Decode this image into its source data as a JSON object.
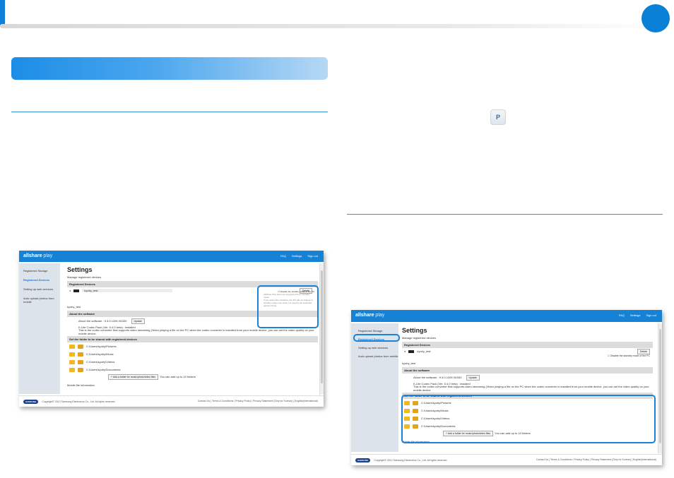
{
  "app": {
    "logo_main": "allshare",
    "logo_sub": "play",
    "nav": [
      "FAQ",
      "Settings",
      "Sign out"
    ]
  },
  "sidebar": {
    "items": [
      "Registered Storage",
      "Registered Devices",
      "Setting up web services",
      "Auto upload photos from mobile"
    ]
  },
  "settings": {
    "title": "Settings",
    "subtitle": "Manage registered devices",
    "registered_devices_label": "Registered Devices",
    "device_name": "kyoby_test",
    "delete_label": "Delete",
    "standby_label": "Disable the standby mode of the PC",
    "standby_note_1": "AllShare Play does not recognize PCs in standby mode.",
    "standby_note_2": "If you select this checkbox, the PC will not change to standby mode even when not used for an extended period of time.",
    "device_heading": "kyoby_test",
    "about_label": "About the software",
    "about_version": "About the software : 9.3.0.1206 N1530",
    "update_label": "Update",
    "codec": "K-Lite Codec Pack (Ver. 5.4.0 beta) : installed",
    "codec_note": "This is the codec converter that supports video streaming (Video playing a file on the PC when the codec converter is installed from your mobile device, you can set the video quality on your mobile device.",
    "folders_label": "Set the folder to be shared with registered devices",
    "folders": [
      "C:\\Users\\kyoby\\Pictures",
      "C:\\Users\\kyoby\\Music",
      "C:\\Users\\kyoby\\Videos",
      "C:\\Users\\kyoby\\Documents"
    ],
    "add_folder_label": "+ Add a folder for music/photo/video files",
    "add_folder_note": "You can add up to 10 folders",
    "mobile_label": "Mobile file information"
  },
  "footer": {
    "samsung": "SAMSUNG",
    "copyright": "Copyright© 2012 Samsung Electronics Co., Ltd. All rights reserved",
    "links": [
      "Contact Us",
      "Terms & Conditions / Privacy Policy",
      "Privacy Statement (Only for Korean)",
      "English(International)"
    ]
  },
  "colors": {
    "accent": "#1682d6",
    "highlight": "#1883d9",
    "sidebar": "#dde3ea"
  }
}
